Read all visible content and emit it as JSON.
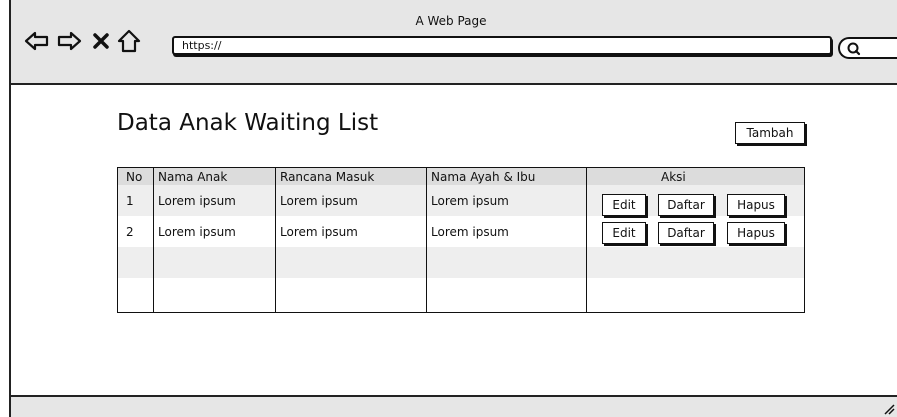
{
  "browser": {
    "title": "A Web Page",
    "url": "https://",
    "nav_icons": [
      "back-arrow-icon",
      "forward-arrow-icon",
      "close-x-icon",
      "home-icon"
    ],
    "search_icon": "search-icon"
  },
  "page": {
    "title": "Data Anak Waiting List",
    "add_button": "Tambah"
  },
  "table": {
    "headers": [
      "No",
      "Nama Anak",
      "Rancana Masuk",
      "Nama Ayah & Ibu",
      "Aksi"
    ],
    "rows": [
      {
        "no": "1",
        "nama_anak": "Lorem ipsum",
        "rencana_masuk": "Lorem ipsum",
        "nama_ortu": "Lorem ipsum"
      },
      {
        "no": "2",
        "nama_anak": "Lorem ipsum",
        "rencana_masuk": "Lorem ipsum",
        "nama_ortu": "Lorem ipsum"
      }
    ],
    "actions": {
      "edit": "Edit",
      "daftar": "Daftar",
      "hapus": "Hapus"
    }
  },
  "colors": {
    "chrome": "#e6e6e6",
    "header_row": "#dcdcdc",
    "stripe_row": "#eeeeee",
    "ink": "#111111"
  }
}
